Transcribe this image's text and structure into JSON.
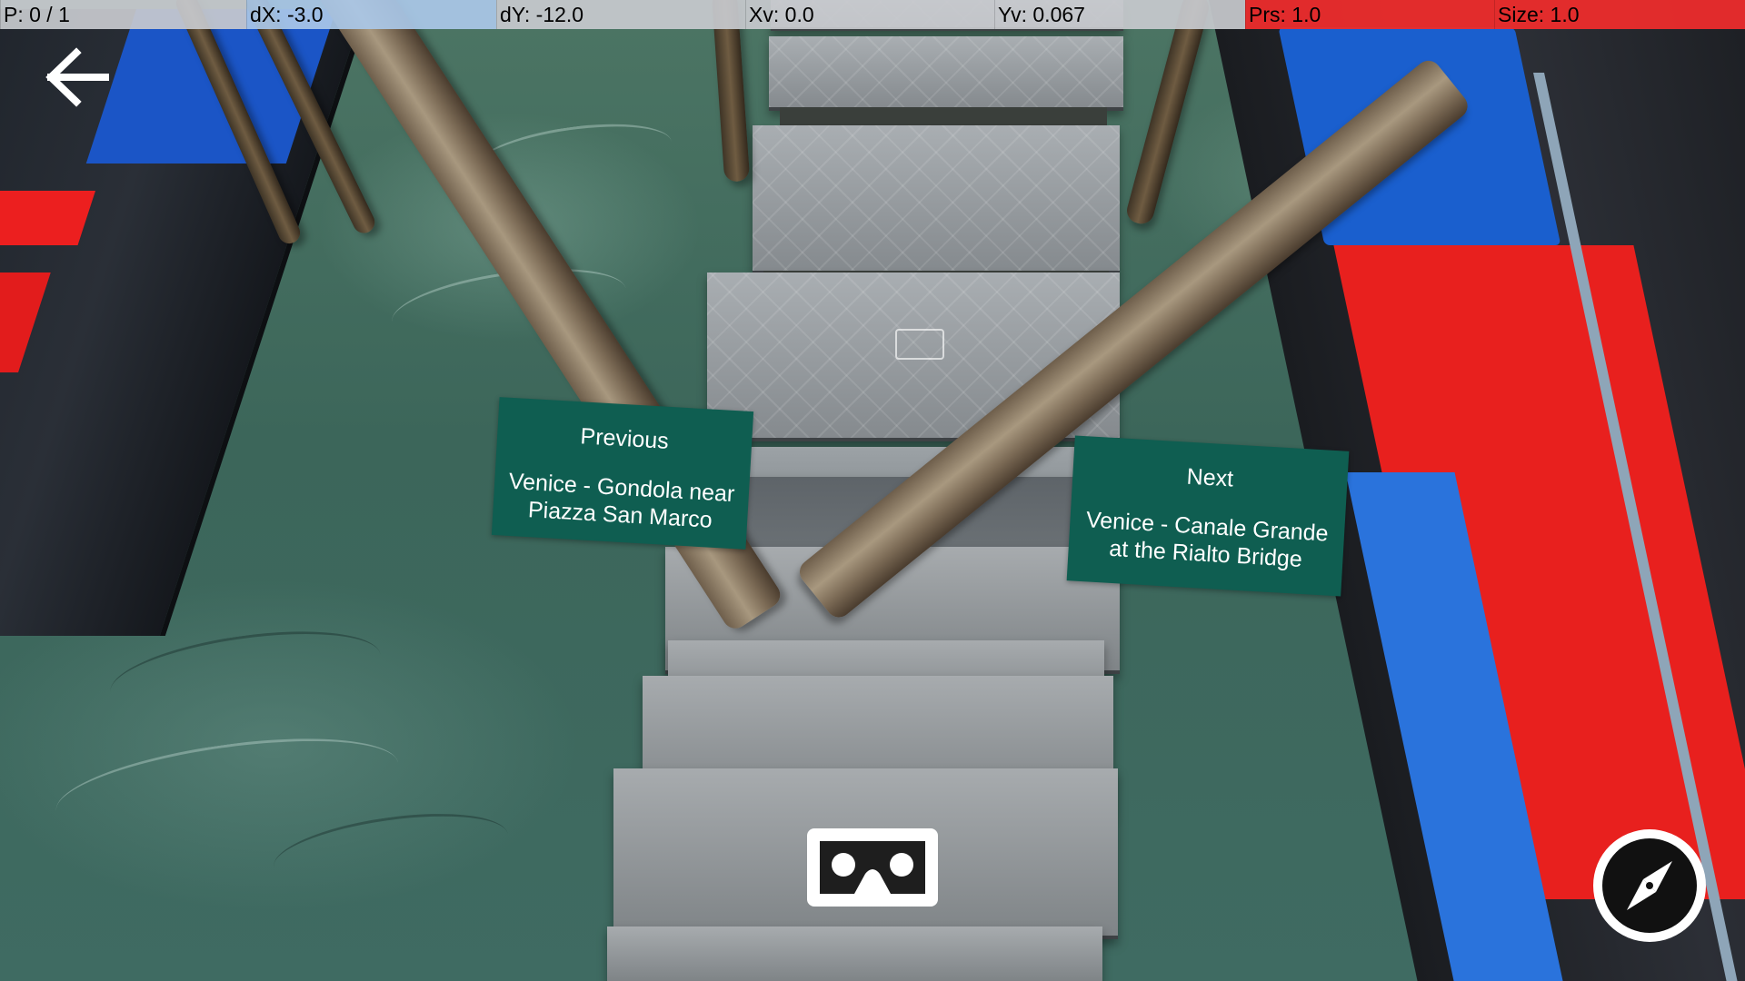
{
  "status_bar": {
    "p": "P: 0 / 1",
    "dx": "dX: -3.0",
    "dy": "dY: -12.0",
    "xv": "Xv: 0.0",
    "yv": "Yv: 0.067",
    "prs": "Prs: 1.0",
    "size": "Size: 1.0"
  },
  "nav": {
    "previous": {
      "label": "Previous",
      "destination_line1": "Venice - Gondola near",
      "destination_line2": "Piazza San Marco"
    },
    "next": {
      "label": "Next",
      "destination_line1": "Venice - Canale Grande",
      "destination_line2": "at the Rialto Bridge"
    }
  },
  "icons": {
    "back": "back-arrow-icon",
    "vr": "cardboard-vr-icon",
    "compass": "compass-icon"
  },
  "colors": {
    "panel": "#0f5e51",
    "status_red": "#ec2c2c",
    "status_blue": "#aac8e8",
    "status_gray": "#c8cace"
  }
}
